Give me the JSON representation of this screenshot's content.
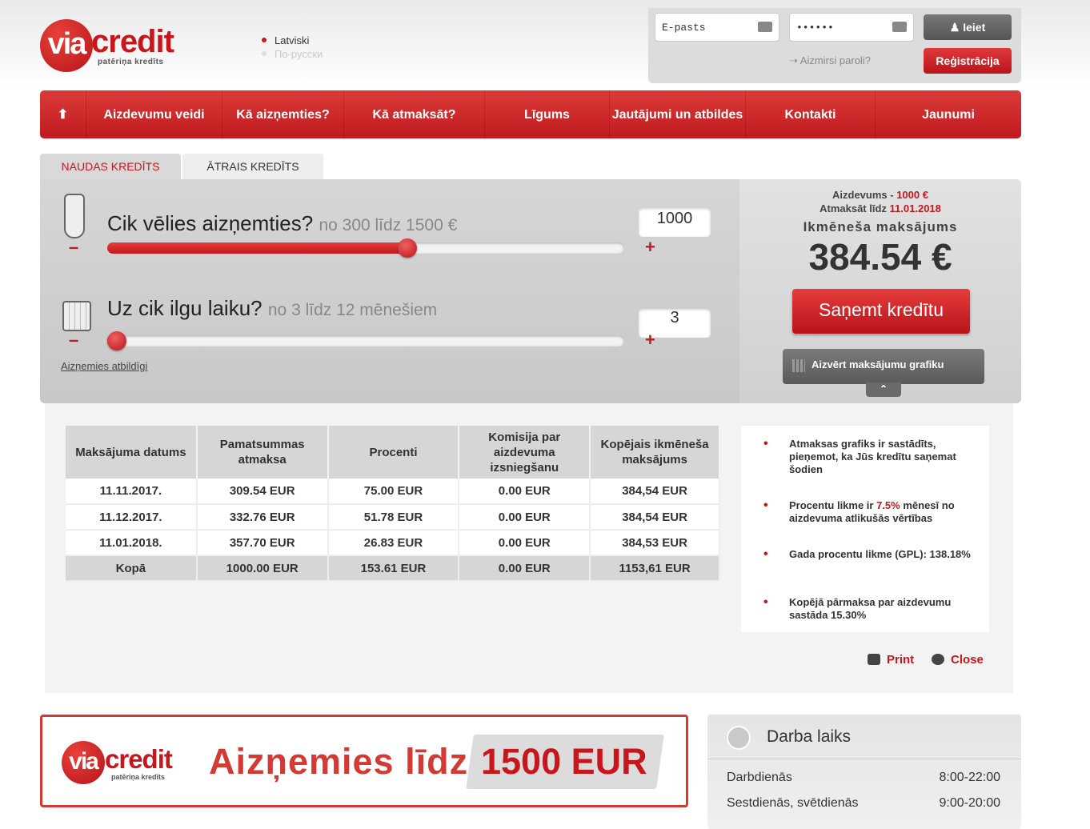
{
  "header": {
    "logo_text_prefix": "via",
    "logo_text_main": "credit",
    "logo_tagline": "patēriņa kredīts",
    "languages": [
      {
        "label": "Latviski",
        "active": true
      },
      {
        "label": "По-русски",
        "active": false
      }
    ],
    "login": {
      "email_placeholder": "E-pasts",
      "password_value": "••••••",
      "login_button": "Ieiet",
      "forgot_link": "Aizmirsi paroli?",
      "register_button": "Reģistrācija"
    }
  },
  "nav": {
    "items": [
      "Aizdevumu veidi",
      "Kā aizņemties?",
      "Kā atmaksāt?",
      "Līgums",
      "Jautājumi un atbildes",
      "Kontakti",
      "Jaunumi"
    ]
  },
  "tabs": {
    "active": "NAUDAS KREDĪTS",
    "inactive": "ĀTRAIS KREDĪTS"
  },
  "calculator": {
    "amount_question": "Cik vēlies aizņemties?",
    "amount_hint": "no 300 līdz 1500 €",
    "amount_value": "1000",
    "amount_fraction": 0.583,
    "period_question": "Uz cik ilgu laiku?",
    "period_hint": "no 3 līdz 12 mēnešiem",
    "period_value": "3",
    "period_fraction": 0,
    "minus": "–",
    "plus": "+",
    "responsible_link": "Aizņemies atbildīgi"
  },
  "summary": {
    "loan_label": "Aizdevums - ",
    "loan_value": "1000 €",
    "repay_label": "Atmaksāt līdz ",
    "repay_value": "11.01.2018",
    "monthly_label": "Ikmēneša maksājums",
    "monthly_amount": "384.54 €",
    "get_button": "Saņemt kredītu",
    "close_schedule": "Aizvērt maksājumu grafiku"
  },
  "schedule": {
    "headers": [
      "Maksājuma datums",
      "Pamatsummas atmaksa",
      "Procenti",
      "Komisija par aizdevuma izsniegšanu",
      "Kopējais ikmēneša maksājums"
    ],
    "rows": [
      [
        "11.11.2017.",
        "309.54 EUR",
        "75.00 EUR",
        "0.00 EUR",
        "384,54 EUR"
      ],
      [
        "11.12.2017.",
        "332.76 EUR",
        "51.78 EUR",
        "0.00 EUR",
        "384,54 EUR"
      ],
      [
        "11.01.2018.",
        "357.70 EUR",
        "26.83 EUR",
        "0.00 EUR",
        "384,53 EUR"
      ]
    ],
    "total": [
      "Kopā",
      "1000.00 EUR",
      "153.61 EUR",
      "0.00 EUR",
      "1153,61 EUR"
    ]
  },
  "notes": {
    "n1": "Atmaksas grafiks ir sastādīts, pieņemot, ka Jūs kredītu saņemat šodien",
    "n2_a": "Procentu likme ir ",
    "n2_rate": "7.5%",
    "n2_b": " mēnesī no aizdevuma atlikušās vērtības",
    "n3": "Gada procentu likme (GPL): 138.18%",
    "n4": "Kopējā pārmaksa par aizdevumu sastāda 15.30%"
  },
  "actions": {
    "print": "Print",
    "close": "Close"
  },
  "banner": {
    "logo_prefix": "via",
    "logo_main": "credit",
    "logo_tagline": "patēriņa kredīts",
    "text": "Aizņemies līdz",
    "amount": "1500 EUR"
  },
  "hours": {
    "title": "Darba laiks",
    "rows": [
      {
        "label": "Darbdienās",
        "value": "8:00-22:00"
      },
      {
        "label": "Sestdienās, svētdienās",
        "value": "9:00-20:00"
      }
    ]
  },
  "colors": {
    "brand_red": "#c8161d",
    "nav_red": "#d33633",
    "gray_panel": "#d0d0d0"
  }
}
